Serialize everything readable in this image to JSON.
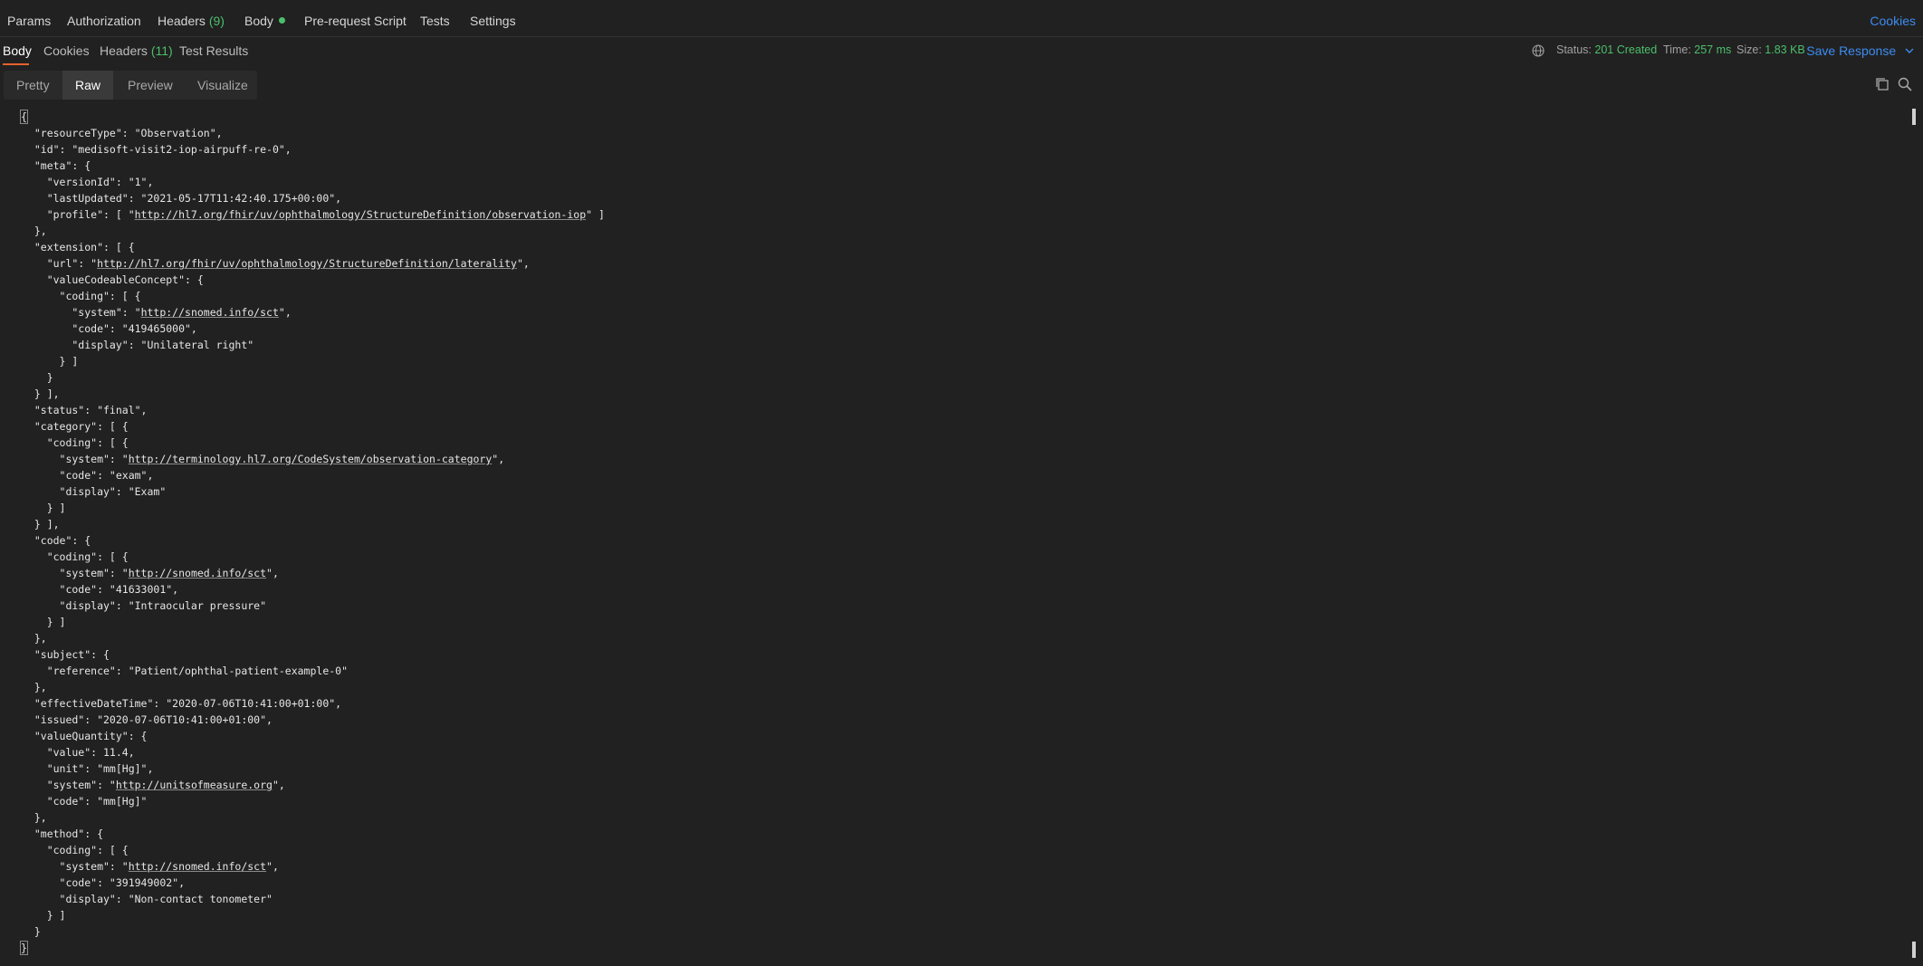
{
  "request_tabs": [
    {
      "label": "Params",
      "count": ""
    },
    {
      "label": "Authorization",
      "count": ""
    },
    {
      "label": "Headers",
      "count": "(9)"
    },
    {
      "label": "Body",
      "count": ""
    },
    {
      "label": "Pre-request Script",
      "count": ""
    },
    {
      "label": "Tests",
      "count": ""
    },
    {
      "label": "Settings",
      "count": ""
    }
  ],
  "cookies_link": "Cookies",
  "response_tabs": [
    {
      "label": "Body",
      "count": ""
    },
    {
      "label": "Cookies",
      "count": ""
    },
    {
      "label": "Headers",
      "count": "(11)"
    },
    {
      "label": "Test Results",
      "count": ""
    }
  ],
  "response_meta": {
    "status_label": "Status:",
    "status_value": "201 Created",
    "time_label": "Time:",
    "time_value": "257 ms",
    "size_label": "Size:",
    "size_value": "1.83 KB",
    "save_label": "Save Response",
    "colors": {
      "ok": "#4cbf6b",
      "link": "#3d8cf0",
      "active_underline": "#e8612c"
    }
  },
  "view_modes": [
    "Pretty",
    "Raw",
    "Preview",
    "Visualize"
  ],
  "active_view": "Raw",
  "icons": [
    "globe-icon",
    "copy-icon",
    "search-icon",
    "chevron-down-icon"
  ],
  "code_lines": [
    {
      "t": "{"
    },
    {
      "t": "  \"resourceType\": \"Observation\","
    },
    {
      "t": "  \"id\": \"medisoft-visit2-iop-airpuff-re-0\","
    },
    {
      "t": "  \"meta\": {"
    },
    {
      "t": "    \"versionId\": \"1\","
    },
    {
      "t": "    \"lastUpdated\": \"2021-05-17T11:42:40.175+00:00\","
    },
    {
      "t": "    \"profile\": [ \"",
      "u": "http://hl7.org/fhir/uv/ophthalmology/StructureDefinition/observation-iop",
      "a": "\" ]"
    },
    {
      "t": "  },"
    },
    {
      "t": "  \"extension\": [ {"
    },
    {
      "t": "    \"url\": \"",
      "u": "http://hl7.org/fhir/uv/ophthalmology/StructureDefinition/laterality",
      "a": "\","
    },
    {
      "t": "    \"valueCodeableConcept\": {"
    },
    {
      "t": "      \"coding\": [ {"
    },
    {
      "t": "        \"system\": \"",
      "u": "http://snomed.info/sct",
      "a": "\","
    },
    {
      "t": "        \"code\": \"419465000\","
    },
    {
      "t": "        \"display\": \"Unilateral right\""
    },
    {
      "t": "      } ]"
    },
    {
      "t": "    }"
    },
    {
      "t": "  } ],"
    },
    {
      "t": "  \"status\": \"final\","
    },
    {
      "t": "  \"category\": [ {"
    },
    {
      "t": "    \"coding\": [ {"
    },
    {
      "t": "      \"system\": \"",
      "u": "http://terminology.hl7.org/CodeSystem/observation-category",
      "a": "\","
    },
    {
      "t": "      \"code\": \"exam\","
    },
    {
      "t": "      \"display\": \"Exam\""
    },
    {
      "t": "    } ]"
    },
    {
      "t": "  } ],"
    },
    {
      "t": "  \"code\": {"
    },
    {
      "t": "    \"coding\": [ {"
    },
    {
      "t": "      \"system\": \"",
      "u": "http://snomed.info/sct",
      "a": "\","
    },
    {
      "t": "      \"code\": \"41633001\","
    },
    {
      "t": "      \"display\": \"Intraocular pressure\""
    },
    {
      "t": "    } ]"
    },
    {
      "t": "  },"
    },
    {
      "t": "  \"subject\": {"
    },
    {
      "t": "    \"reference\": \"Patient/ophthal-patient-example-0\""
    },
    {
      "t": "  },"
    },
    {
      "t": "  \"effectiveDateTime\": \"2020-07-06T10:41:00+01:00\","
    },
    {
      "t": "  \"issued\": \"2020-07-06T10:41:00+01:00\","
    },
    {
      "t": "  \"valueQuantity\": {"
    },
    {
      "t": "    \"value\": 11.4,"
    },
    {
      "t": "    \"unit\": \"mm[Hg]\","
    },
    {
      "t": "    \"system\": \"",
      "u": "http://unitsofmeasure.org",
      "a": "\","
    },
    {
      "t": "    \"code\": \"mm[Hg]\""
    },
    {
      "t": "  },"
    },
    {
      "t": "  \"method\": {"
    },
    {
      "t": "    \"coding\": [ {"
    },
    {
      "t": "      \"system\": \"",
      "u": "http://snomed.info/sct",
      "a": "\","
    },
    {
      "t": "      \"code\": \"391949002\","
    },
    {
      "t": "      \"display\": \"Non-contact tonometer\""
    },
    {
      "t": "    } ]"
    },
    {
      "t": "  }"
    },
    {
      "t": "}"
    }
  ]
}
